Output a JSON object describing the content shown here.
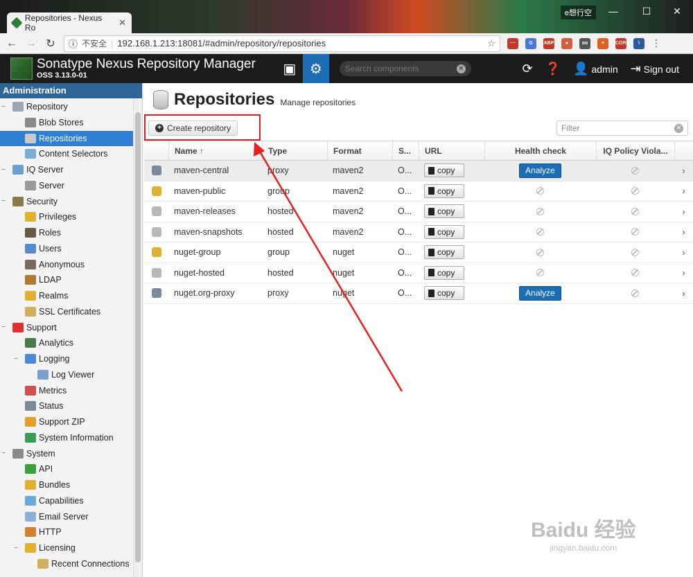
{
  "browser": {
    "tab_title": "Repositories - Nexus Ro",
    "window_user": "e想行空",
    "insecure_label": "不安全",
    "url": "192.168.1.213:18081/#admin/repository/repositories",
    "extensions": [
      "····",
      "G",
      "ABP",
      "●",
      "oo",
      "✦",
      "CORS",
      "\\"
    ]
  },
  "header": {
    "product_name": "Sonatype Nexus Repository Manager",
    "version": "OSS 3.13.0-01",
    "search_placeholder": "Search components",
    "user": "admin",
    "signout": "Sign out"
  },
  "sidebar": {
    "title": "Administration",
    "items": [
      {
        "label": "Repository",
        "level": 0,
        "toggle": "−",
        "icon_color": "#9aa8b5"
      },
      {
        "label": "Blob Stores",
        "level": 1,
        "icon_color": "#8a8a8a"
      },
      {
        "label": "Repositories",
        "level": 1,
        "icon_color": "#c8c8c8",
        "selected": true
      },
      {
        "label": "Content Selectors",
        "level": 1,
        "icon_color": "#7ab0d8"
      },
      {
        "label": "IQ Server",
        "level": 0,
        "toggle": "−",
        "icon_color": "#6b9fd4"
      },
      {
        "label": "Server",
        "level": 1,
        "icon_color": "#9a9a9a"
      },
      {
        "label": "Security",
        "level": 0,
        "toggle": "−",
        "icon_color": "#8a7a4a"
      },
      {
        "label": "Privileges",
        "level": 1,
        "icon_color": "#e0b030"
      },
      {
        "label": "Roles",
        "level": 1,
        "icon_color": "#6a5a4a"
      },
      {
        "label": "Users",
        "level": 1,
        "icon_color": "#5a8acb"
      },
      {
        "label": "Anonymous",
        "level": 1,
        "icon_color": "#7a6a5a"
      },
      {
        "label": "LDAP",
        "level": 1,
        "icon_color": "#b07a30"
      },
      {
        "label": "Realms",
        "level": 1,
        "icon_color": "#e0b030"
      },
      {
        "label": "SSL Certificates",
        "level": 1,
        "icon_color": "#d0b060"
      },
      {
        "label": "Support",
        "level": 0,
        "toggle": "−",
        "icon_color": "#e03030"
      },
      {
        "label": "Analytics",
        "level": 1,
        "icon_color": "#4a7a4a"
      },
      {
        "label": "Logging",
        "level": 1,
        "toggle": "−",
        "icon_color": "#4a8ad4"
      },
      {
        "label": "Log Viewer",
        "level": 2,
        "icon_color": "#7aa0d0"
      },
      {
        "label": "Metrics",
        "level": 1,
        "icon_color": "#d05050"
      },
      {
        "label": "Status",
        "level": 1,
        "icon_color": "#7a8a9a"
      },
      {
        "label": "Support ZIP",
        "level": 1,
        "icon_color": "#e0a030"
      },
      {
        "label": "System Information",
        "level": 1,
        "icon_color": "#3a9a5a"
      },
      {
        "label": "System",
        "level": 0,
        "toggle": "−",
        "icon_color": "#8a8a8a"
      },
      {
        "label": "API",
        "level": 1,
        "icon_color": "#3aa03a"
      },
      {
        "label": "Bundles",
        "level": 1,
        "icon_color": "#e0b030"
      },
      {
        "label": "Capabilities",
        "level": 1,
        "icon_color": "#6aaad8"
      },
      {
        "label": "Email Server",
        "level": 1,
        "icon_color": "#8ab0d8"
      },
      {
        "label": "HTTP",
        "level": 1,
        "icon_color": "#d08030"
      },
      {
        "label": "Licensing",
        "level": 1,
        "toggle": "−",
        "icon_color": "#e0b030"
      },
      {
        "label": "Recent Connections",
        "level": 2,
        "icon_color": "#d0b060"
      }
    ]
  },
  "main": {
    "title": "Repositories",
    "subtitle": "Manage repositories",
    "create_label": "Create repository",
    "filter_placeholder": "Filter",
    "columns": [
      "Name ↑",
      "Type",
      "Format",
      "S...",
      "URL",
      "Health check",
      "IQ Policy Viola..."
    ],
    "copy_label": "copy",
    "analyze_label": "Analyze",
    "rows": [
      {
        "name": "maven-central",
        "type": "proxy",
        "format": "maven2",
        "status": "O...",
        "health": "analyze",
        "icon_color": "#7a8a9a"
      },
      {
        "name": "maven-public",
        "type": "group",
        "format": "maven2",
        "status": "O...",
        "health": "na",
        "icon_color": "#e0b030"
      },
      {
        "name": "maven-releases",
        "type": "hosted",
        "format": "maven2",
        "status": "O...",
        "health": "na",
        "icon_color": "#b8b8b8"
      },
      {
        "name": "maven-snapshots",
        "type": "hosted",
        "format": "maven2",
        "status": "O...",
        "health": "na",
        "icon_color": "#b8b8b8"
      },
      {
        "name": "nuget-group",
        "type": "group",
        "format": "nuget",
        "status": "O...",
        "health": "na",
        "icon_color": "#e0b030"
      },
      {
        "name": "nuget-hosted",
        "type": "hosted",
        "format": "nuget",
        "status": "O...",
        "health": "na",
        "icon_color": "#b8b8b8"
      },
      {
        "name": "nuget.org-proxy",
        "type": "proxy",
        "format": "nuget",
        "status": "O...",
        "health": "analyze",
        "icon_color": "#7a8a9a"
      }
    ]
  },
  "watermark": {
    "text": "Baidu 经验",
    "sub": "jingyan.baidu.com"
  }
}
